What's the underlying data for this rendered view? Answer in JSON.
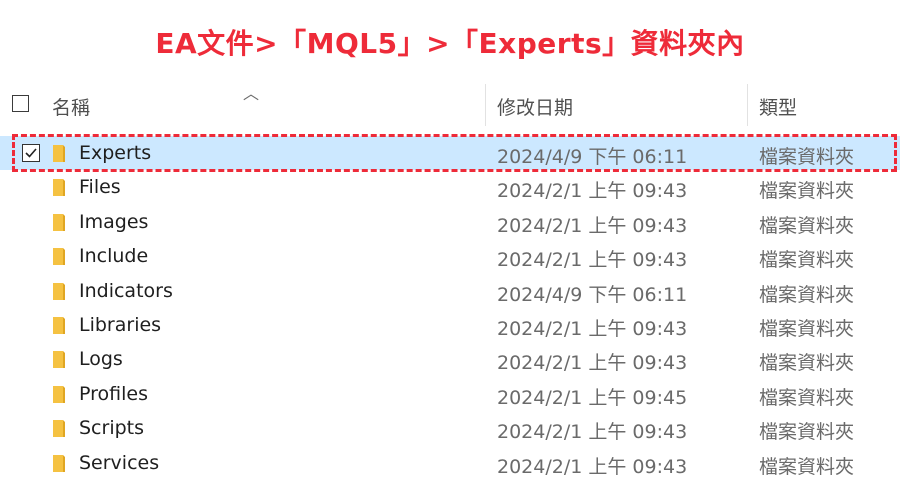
{
  "banner": {
    "text": "EA文件>「MQL5」>「Experts」資料夾內"
  },
  "header": {
    "name_label": "名稱",
    "date_label": "修改日期",
    "type_label": "類型",
    "sort_icon": "chevron-up-icon"
  },
  "rows": [
    {
      "name": "Experts",
      "date": "2024/4/9 下午 06:11",
      "type": "檔案資料夾",
      "selected": true,
      "checked": true
    },
    {
      "name": "Files",
      "date": "2024/2/1 上午 09:43",
      "type": "檔案資料夾"
    },
    {
      "name": "Images",
      "date": "2024/2/1 上午 09:43",
      "type": "檔案資料夾"
    },
    {
      "name": "Include",
      "date": "2024/2/1 上午 09:43",
      "type": "檔案資料夾"
    },
    {
      "name": "Indicators",
      "date": "2024/4/9 下午 06:11",
      "type": "檔案資料夾"
    },
    {
      "name": "Libraries",
      "date": "2024/2/1 上午 09:43",
      "type": "檔案資料夾"
    },
    {
      "name": "Logs",
      "date": "2024/2/1 上午 09:43",
      "type": "檔案資料夾"
    },
    {
      "name": "Profiles",
      "date": "2024/2/1 上午 09:45",
      "type": "檔案資料夾"
    },
    {
      "name": "Scripts",
      "date": "2024/2/1 上午 09:43",
      "type": "檔案資料夾"
    },
    {
      "name": "Services",
      "date": "2024/2/1 上午 09:43",
      "type": "檔案資料夾"
    }
  ],
  "colors": {
    "banner": "#ee2b39",
    "selected_row": "#cce8ff",
    "folder": "#f5c242",
    "highlight_border": "#ee2b39"
  }
}
